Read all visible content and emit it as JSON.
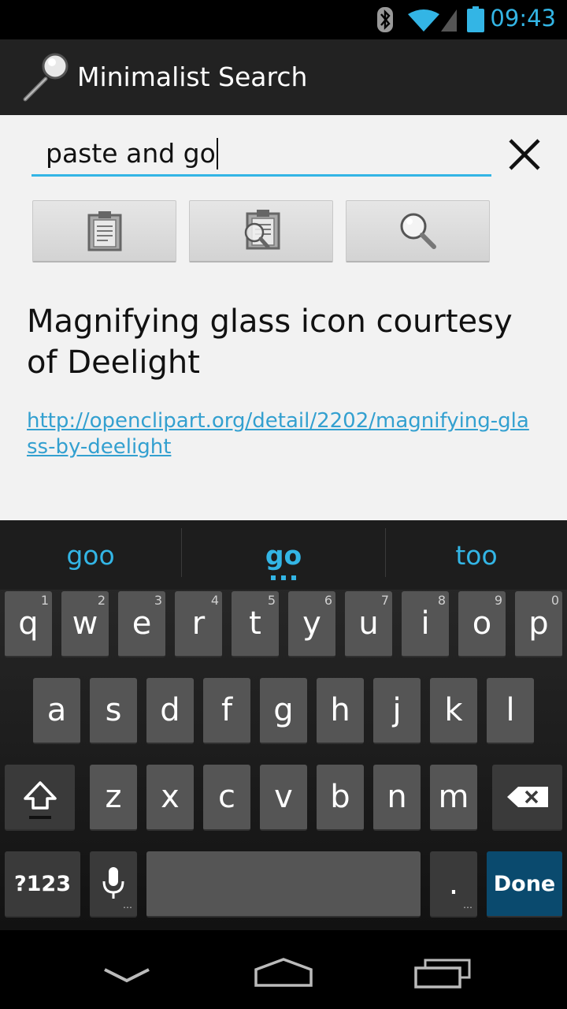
{
  "status_bar": {
    "time": "09:43"
  },
  "app": {
    "title": "Minimalist Search"
  },
  "search": {
    "value": "paste and go"
  },
  "buttons": [
    {
      "name": "paste-button",
      "icon": "clipboard-icon"
    },
    {
      "name": "paste-and-search-button",
      "icon": "clipboard-search-icon"
    },
    {
      "name": "search-button",
      "icon": "magnifier-icon"
    }
  ],
  "credit": {
    "text": "Magnifying glass icon courtesy of Deelight",
    "link": "http://openclipart.org/detail/2202/magnifying-glass-by-deelight"
  },
  "keyboard": {
    "suggestions": [
      "goo",
      "go",
      "too"
    ],
    "row1": [
      "q",
      "w",
      "e",
      "r",
      "t",
      "y",
      "u",
      "i",
      "o",
      "p"
    ],
    "row1_hints": [
      "1",
      "2",
      "3",
      "4",
      "5",
      "6",
      "7",
      "8",
      "9",
      "0"
    ],
    "row2": [
      "a",
      "s",
      "d",
      "f",
      "g",
      "h",
      "j",
      "k",
      "l"
    ],
    "row3": [
      "z",
      "x",
      "c",
      "v",
      "b",
      "n",
      "m"
    ],
    "symbols_label": "?123",
    "period_label": ".",
    "done_label": "Done"
  },
  "colors": {
    "accent": "#33b5e5",
    "actionbar": "#222222",
    "content": "#f2f2f2",
    "done": "#0a4a6e"
  }
}
